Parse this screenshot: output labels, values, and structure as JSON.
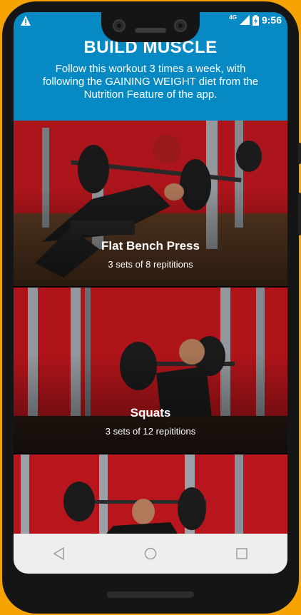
{
  "status_bar": {
    "warning_icon": "warning-triangle-icon",
    "network": "4G",
    "time": "9:56"
  },
  "header": {
    "title": "BUILD MUSCLE",
    "description": "Follow this workout 3 times a week, with following the GAINING WEIGHT diet from the Nutrition Feature of the app.",
    "background": "#078ac4"
  },
  "workouts": [
    {
      "name": "Flat Bench Press",
      "detail": "3 sets of 8 repititions"
    },
    {
      "name": "Squats",
      "detail": "3 sets of 12 repititions"
    },
    {
      "name": "",
      "detail": ""
    }
  ],
  "nav_bar": {
    "back_icon": "back-triangle-icon",
    "home_icon": "home-circle-icon",
    "recents_icon": "recents-square-icon"
  },
  "colors": {
    "accent": "#078ac4",
    "gym_wall": "#c0141b",
    "frame": "#f5a300"
  }
}
